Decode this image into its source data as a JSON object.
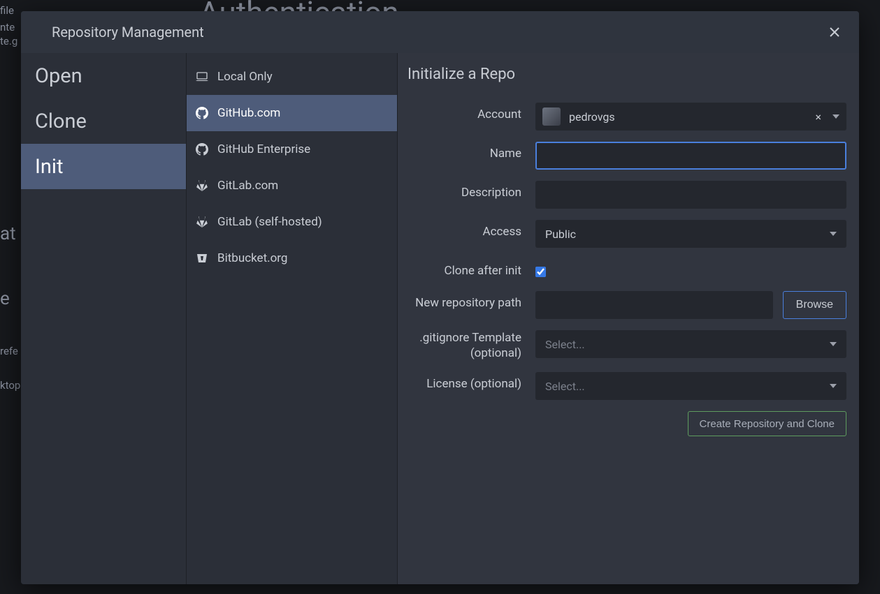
{
  "backdrop": {
    "title": "Authentication",
    "frag1": "file",
    "frag2": "nte",
    "frag3": "te.g",
    "frag4": "at",
    "frag5": "e",
    "frag6": "refe",
    "frag7": "ktop"
  },
  "dialog": {
    "title": "Repository Management"
  },
  "tabs": {
    "open": "Open",
    "clone": "Clone",
    "init": "Init"
  },
  "providers": {
    "local": "Local Only",
    "github": "GitHub.com",
    "ghe": "GitHub Enterprise",
    "gitlab": "GitLab.com",
    "gitlab_self": "GitLab (self-hosted)",
    "bitbucket": "Bitbucket.org"
  },
  "form": {
    "title": "Initialize a Repo",
    "labels": {
      "account": "Account",
      "name": "Name",
      "description": "Description",
      "access": "Access",
      "clone_after": "Clone after init",
      "repo_path": "New repository path",
      "gitignore": ".gitignore Template (optional)",
      "license": "License (optional)"
    },
    "account_value": "pedrovgs",
    "name_value": "",
    "description_value": "",
    "access_value": "Public",
    "clone_after_checked": true,
    "repo_path_value": "",
    "browse_label": "Browse",
    "gitignore_placeholder": "Select...",
    "license_placeholder": "Select...",
    "submit_label": "Create Repository and Clone"
  }
}
